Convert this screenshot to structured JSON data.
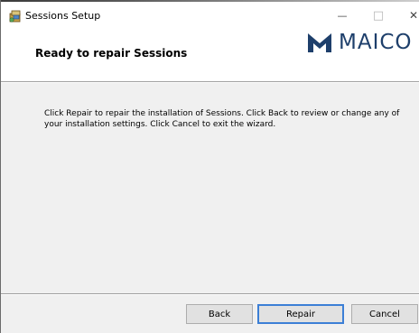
{
  "window": {
    "title": "Sessions Setup",
    "app_icon": "installer-package-icon"
  },
  "controls": {
    "minimize_glyph": "—",
    "maximize_glyph": "□",
    "close_glyph": "✕"
  },
  "banner": {
    "title": "Ready to repair Sessions",
    "logo_text": "MAICO",
    "logo_icon": "maico-logo-icon",
    "logo_color": "#1e3f6b"
  },
  "body": {
    "message": "Click Repair to repair the installation of Sessions. Click Back to review or change any of your installation settings. Click Cancel to exit the wizard."
  },
  "buttons": {
    "back": "Back",
    "repair": "Repair",
    "cancel": "Cancel"
  },
  "colors": {
    "focus_border": "#3c7fd6",
    "panel_background": "#f0f0f0"
  }
}
